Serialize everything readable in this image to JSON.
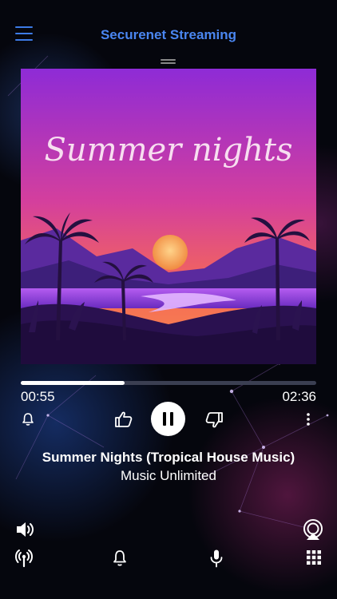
{
  "header": {
    "title": "Securenet Streaming",
    "menu_icon": "hamburger-menu-icon",
    "accent": "#4a86f0"
  },
  "artwork": {
    "text": "Summer nights",
    "sky_top": "#9b2fd0",
    "sky_bottom": "#f46a5b",
    "sun": "#f7a35c"
  },
  "player": {
    "elapsed": "00:55",
    "total": "02:36",
    "progress": 0.352
  },
  "track": {
    "title": "Summer Nights (Tropical House Music)",
    "artist": "Music Unlimited"
  },
  "controls": {
    "alarm": "alarm-bell-icon",
    "like": "thumbs-up-icon",
    "pause": "pause-icon",
    "dislike": "thumbs-down-icon",
    "more": "more-vertical-icon"
  },
  "bottom": {
    "volume": "speaker-volume-icon",
    "airplay": "airplay-icon",
    "broadcast": "broadcast-icon",
    "notifications": "bell-icon",
    "microphone": "microphone-icon",
    "grid": "grid-icon"
  }
}
